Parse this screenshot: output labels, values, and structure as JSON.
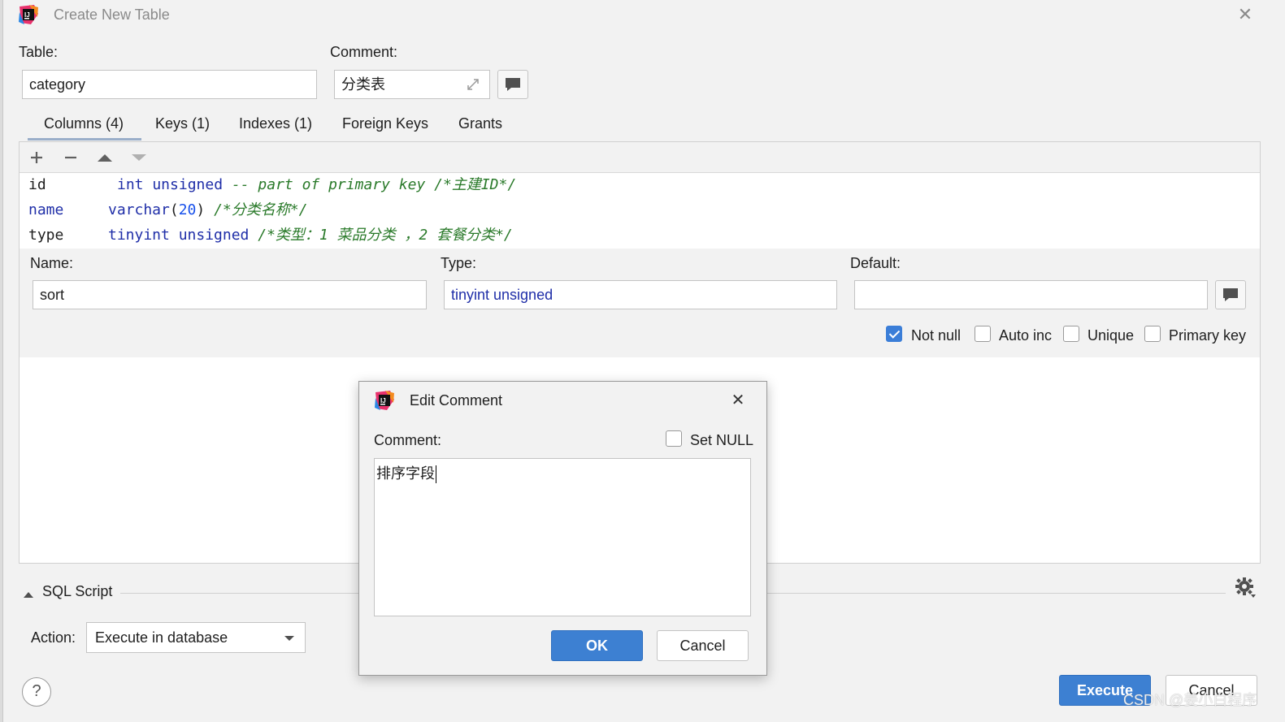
{
  "window": {
    "title": "Create New Table"
  },
  "table": {
    "label": "Table:",
    "value": "category"
  },
  "comment": {
    "label": "Comment:",
    "value": "分类表"
  },
  "tabs": [
    {
      "label": "Columns (4)",
      "active": true
    },
    {
      "label": "Keys (1)"
    },
    {
      "label": "Indexes (1)"
    },
    {
      "label": "Foreign Keys"
    },
    {
      "label": "Grants"
    }
  ],
  "columns": [
    {
      "name": "id",
      "type_kw": "int unsigned",
      "type_num": "",
      "type_after": "",
      "comment": "-- part of primary key /*主建ID*/"
    },
    {
      "name": "name",
      "type_kw": "varchar",
      "type_num": "20",
      "type_after": ")",
      "comment": "/*分类名称*/"
    },
    {
      "name": "type",
      "type_kw": "tinyint unsigned",
      "type_num": "",
      "type_after": "",
      "comment": "/*类型：1 菜品分类 ，2 套餐分类*/"
    }
  ],
  "editor": {
    "name_label": "Name:",
    "name_value": "sort",
    "type_label": "Type:",
    "type_value": "tinyint unsigned",
    "default_label": "Default:",
    "default_value": "",
    "not_null": "Not null",
    "auto_inc": "Auto inc",
    "unique": "Unique",
    "primary_key": "Primary key"
  },
  "sql_script": {
    "label": "SQL Script",
    "action_label": "Action:",
    "action_value": "Execute in database"
  },
  "footer": {
    "help": "?",
    "execute": "Execute",
    "cancel": "Cancel"
  },
  "dialog": {
    "title": "Edit Comment",
    "comment_label": "Comment:",
    "set_null": "Set NULL",
    "text": "排序字段",
    "ok": "OK",
    "cancel": "Cancel"
  },
  "watermark": "CSDN @姜小白程序",
  "colors": {
    "accent": "#3d80d2",
    "keyword": "#1f2ea8",
    "comment": "#2a7a2a"
  }
}
